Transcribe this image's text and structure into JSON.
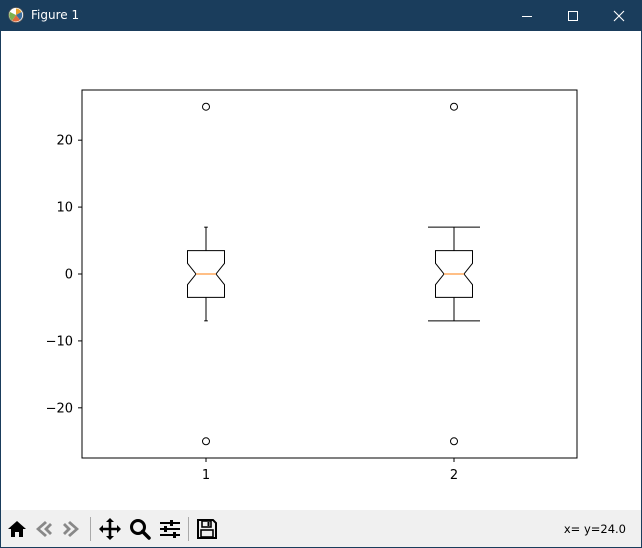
{
  "window": {
    "title": "Figure 1",
    "titlebar_color": "#1a3d5c",
    "icons": [
      "matplotlib-icon",
      "minimize-icon",
      "maximize-icon",
      "close-icon"
    ]
  },
  "toolbar": {
    "buttons": [
      "home-icon",
      "back-icon",
      "forward-icon",
      "pan-icon",
      "zoom-icon",
      "configure-subplots-icon",
      "save-icon"
    ],
    "coords_readout": "x= y=24.0"
  },
  "chart_data": {
    "type": "boxplot",
    "notched": true,
    "categories": [
      "1",
      "2"
    ],
    "xticks": [
      "1",
      "2"
    ],
    "yticks": [
      -20,
      -10,
      0,
      10,
      20
    ],
    "ylim": [
      -27.5,
      27.5
    ],
    "grid": false,
    "median_color": "#ff7f0e",
    "box_color": "#000000",
    "boxes": [
      {
        "label": "1",
        "median": 0,
        "q1": -3.5,
        "q3": 3.5,
        "whisker_low": -7,
        "whisker_high": 7,
        "notch_low": -1.6,
        "notch_high": 1.6,
        "outliers": [
          25,
          -25
        ],
        "cap": "narrow"
      },
      {
        "label": "2",
        "median": 0,
        "q1": -3.5,
        "q3": 3.5,
        "whisker_low": -7,
        "whisker_high": 7,
        "notch_low": -1.6,
        "notch_high": 1.6,
        "outliers": [
          25,
          -25
        ],
        "cap": "wide"
      }
    ]
  }
}
